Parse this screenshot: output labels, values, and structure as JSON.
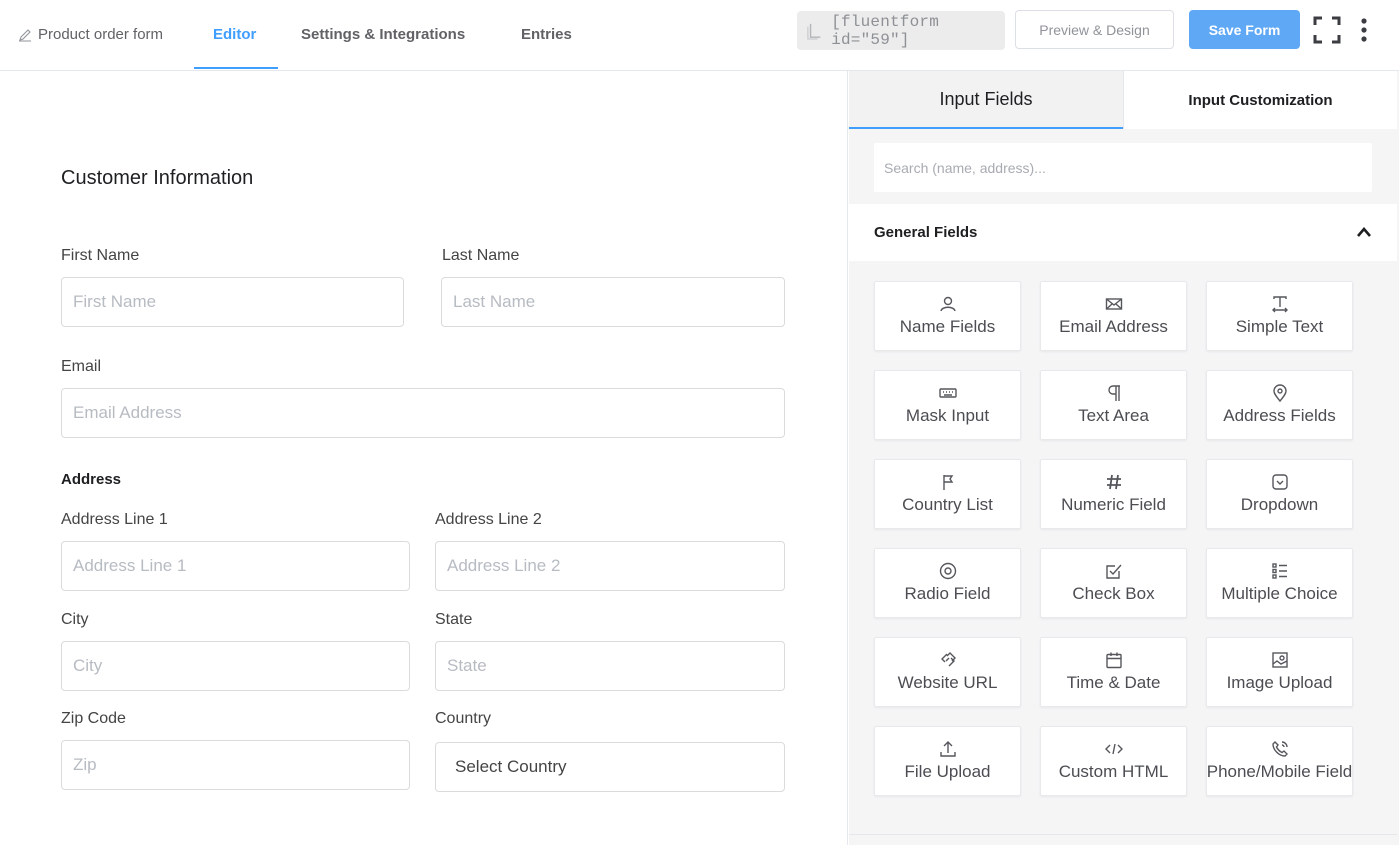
{
  "header": {
    "breadcrumb": "Product order form",
    "tabs": [
      "Editor",
      "Settings & Integrations",
      "Entries"
    ],
    "active_tab": "Editor",
    "shortcode": "[fluentform id=\"59\"]",
    "preview_label": "Preview & Design",
    "save_label": "Save Form"
  },
  "form": {
    "section_title": "Customer Information",
    "first_name": {
      "label": "First Name",
      "placeholder": "First Name"
    },
    "last_name": {
      "label": "Last Name",
      "placeholder": "Last Name"
    },
    "email": {
      "label": "Email",
      "placeholder": "Email Address"
    },
    "address_heading": "Address",
    "address1": {
      "label": "Address Line 1",
      "placeholder": "Address Line 1"
    },
    "address2": {
      "label": "Address Line 2",
      "placeholder": "Address Line 2"
    },
    "city": {
      "label": "City",
      "placeholder": "City"
    },
    "state": {
      "label": "State",
      "placeholder": "State"
    },
    "zip": {
      "label": "Zip Code",
      "placeholder": "Zip"
    },
    "country": {
      "label": "Country",
      "value": "Select Country"
    }
  },
  "panel": {
    "tabs": [
      "Input Fields",
      "Input Customization"
    ],
    "active_tab": "Input Fields",
    "search_placeholder": "Search (name, address)...",
    "group_title": "General Fields",
    "fields": [
      {
        "label": "Name Fields",
        "icon": "user-icon"
      },
      {
        "label": "Email Address",
        "icon": "envelope-icon"
      },
      {
        "label": "Simple Text",
        "icon": "text-icon"
      },
      {
        "label": "Mask Input",
        "icon": "keyboard-icon"
      },
      {
        "label": "Text Area",
        "icon": "paragraph-icon"
      },
      {
        "label": "Address Fields",
        "icon": "map-pin-icon"
      },
      {
        "label": "Country List",
        "icon": "flag-icon"
      },
      {
        "label": "Numeric Field",
        "icon": "hash-icon"
      },
      {
        "label": "Dropdown",
        "icon": "dropdown-icon"
      },
      {
        "label": "Radio Field",
        "icon": "radio-icon"
      },
      {
        "label": "Check Box",
        "icon": "checkbox-icon"
      },
      {
        "label": "Multiple Choice",
        "icon": "list-icon"
      },
      {
        "label": "Website URL",
        "icon": "link-icon"
      },
      {
        "label": "Time & Date",
        "icon": "calendar-icon"
      },
      {
        "label": "Image Upload",
        "icon": "image-icon"
      },
      {
        "label": "File Upload",
        "icon": "upload-icon"
      },
      {
        "label": "Custom HTML",
        "icon": "code-icon"
      },
      {
        "label": "Phone/Mobile Field",
        "icon": "phone-icon"
      }
    ]
  },
  "colors": {
    "accent": "#409eff",
    "save_button": "#5fa8f5",
    "panel_bg": "#f5f5f6"
  }
}
